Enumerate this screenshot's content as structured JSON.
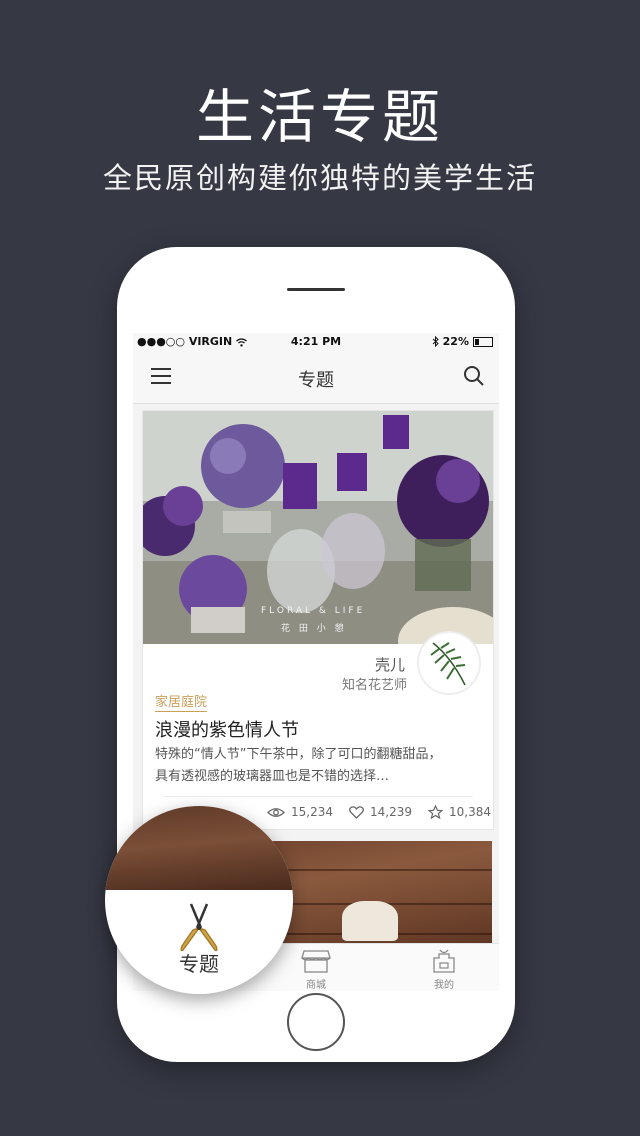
{
  "promo": {
    "title": "生活专题",
    "subtitle": "全民原创构建你独特的美学生活"
  },
  "statusbar": {
    "carrier": "●●●○○ VIRGIN",
    "time": "4:21 PM",
    "battery": "22%"
  },
  "navbar": {
    "title": "专题",
    "menu_icon": "menu-icon",
    "search_icon": "search-icon"
  },
  "card": {
    "image_caption": "FLORAL & LIFE",
    "image_caption_cn": "花 田 小 憩",
    "author_name": "壳儿",
    "author_title": "知名花艺师",
    "tag": "家居庭院",
    "title": "浪漫的紫色情人节",
    "desc_line1": "特殊的“情人节”下午茶中，除了可口的翻糖甜品，",
    "desc_line2": "具有透视感的玻璃器皿也是不错的选择…",
    "views": "15,234",
    "likes": "14,239",
    "favorites": "10,384"
  },
  "tabbar": {
    "tabs": [
      {
        "label": "专题",
        "icon": "scissors-icon"
      },
      {
        "label": "商城",
        "icon": "shop-icon"
      },
      {
        "label": "我的",
        "icon": "apron-icon"
      }
    ]
  },
  "colors": {
    "background": "#363844",
    "accent": "#c9a05a",
    "purple": "#5b2a8c"
  }
}
